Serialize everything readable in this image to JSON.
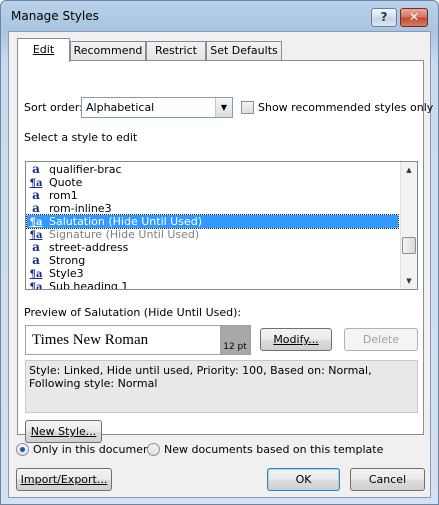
{
  "window": {
    "title": "Manage Styles",
    "help_label": "?",
    "close_label": "✕"
  },
  "tabs": [
    {
      "label": "Edit",
      "active": true
    },
    {
      "label": "Recommend",
      "active": false
    },
    {
      "label": "Restrict",
      "active": false
    },
    {
      "label": "Set Defaults",
      "active": false
    }
  ],
  "sort": {
    "label": "Sort order:",
    "value": "Alphabetical",
    "arrow": "▼"
  },
  "show_recommended": {
    "label": "Show recommended styles only",
    "checked": false
  },
  "select_label": "Select a style to edit",
  "styles": [
    {
      "icon": "a",
      "type": "character",
      "name": "qualifier-brac",
      "state": "normal"
    },
    {
      "icon": "¶a",
      "type": "linked",
      "name": "Quote",
      "state": "normal"
    },
    {
      "icon": "a",
      "type": "character",
      "name": "rom1",
      "state": "normal"
    },
    {
      "icon": "a",
      "type": "character",
      "name": "rom-inline3",
      "state": "normal"
    },
    {
      "icon": "¶a",
      "type": "linked",
      "name": "Salutation  (Hide Until Used)",
      "state": "selected"
    },
    {
      "icon": "¶a",
      "type": "linked",
      "name": "Signature  (Hide Until Used)",
      "state": "disabled"
    },
    {
      "icon": "a",
      "type": "character",
      "name": "street-address",
      "state": "normal"
    },
    {
      "icon": "a",
      "type": "character",
      "name": "Strong",
      "state": "normal"
    },
    {
      "icon": "¶a",
      "type": "linked",
      "name": "Style3",
      "state": "normal"
    },
    {
      "icon": "¶a",
      "type": "linked",
      "name": "Sub heading 1",
      "state": "normal"
    }
  ],
  "scrollbar": {
    "up": "▲",
    "down": "▼"
  },
  "preview": {
    "label": "Preview of Salutation  (Hide Until Used):",
    "font_name": "Times New Roman",
    "font_size": "12 pt"
  },
  "buttons": {
    "modify": "Modify...",
    "delete": "Delete",
    "new_style": "New Style...",
    "import_export": "Import/Export...",
    "ok": "OK",
    "cancel": "Cancel"
  },
  "description": "Style: Linked, Hide until used, Priority: 100, Based on: Normal, Following style: Normal",
  "scope": {
    "only_this_doc": "Only in this document",
    "new_docs": "New documents based on this template",
    "selected": "only_this_doc"
  }
}
